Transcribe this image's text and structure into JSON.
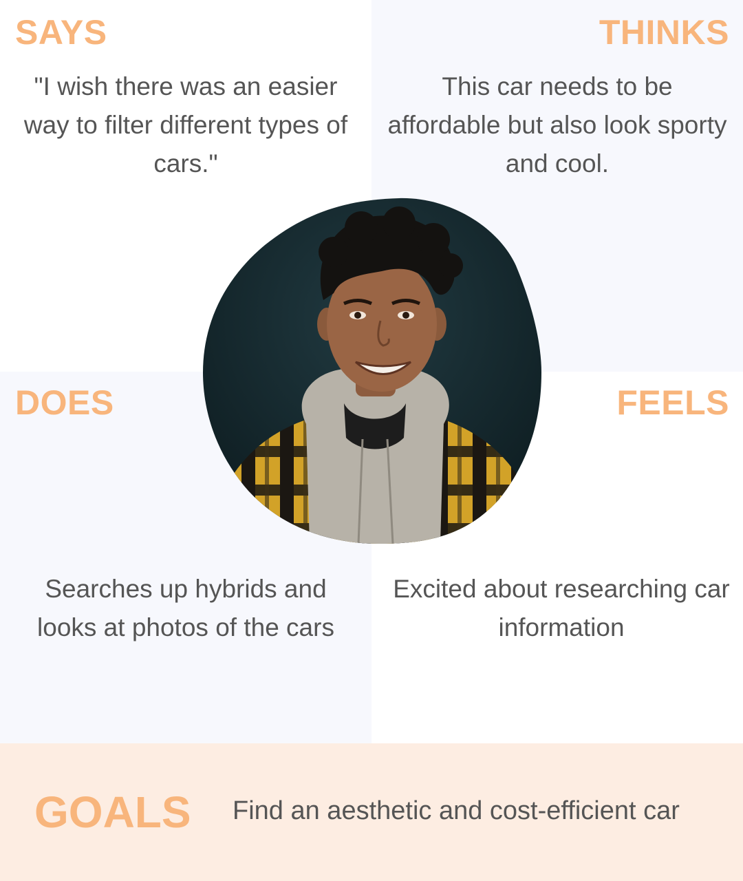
{
  "says": {
    "heading": "SAYS",
    "text": "\"I wish there was an easier way to filter different types of cars.\""
  },
  "thinks": {
    "heading": "THINKS",
    "text": "This car needs to be affordable but also look sporty and cool."
  },
  "does": {
    "heading": "DOES",
    "text": "Searches up hybrids and looks at photos of the cars"
  },
  "feels": {
    "heading": "FEELS",
    "text": "Excited about researching car information"
  },
  "goals": {
    "heading": "GOALS",
    "text": "Find an aesthetic and cost-efficient car"
  },
  "colors": {
    "accent": "#f8b57c",
    "text": "#555555",
    "panel_alt": "#f7f8fd",
    "goals_bg": "#fdede2"
  }
}
